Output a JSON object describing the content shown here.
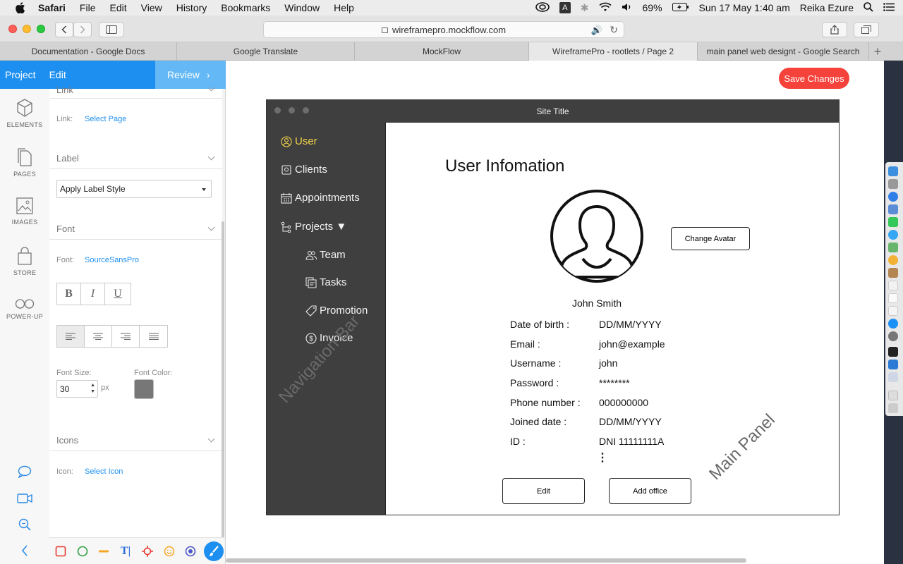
{
  "menubar": {
    "items": [
      "Safari",
      "File",
      "Edit",
      "View",
      "History",
      "Bookmarks",
      "Window",
      "Help"
    ],
    "status": {
      "battery": "69%",
      "datetime": "Sun 17 May  1:40 am",
      "user": "Reika Ezure",
      "input_source": "A"
    }
  },
  "browser": {
    "url": "wireframepro.mockflow.com",
    "tabs": [
      "Documentation - Google Docs",
      "Google Translate",
      "MockFlow",
      "WireframePro - rootlets / Page 2",
      "main panel web designt - Google Search"
    ],
    "active_tab_index": 3
  },
  "editor": {
    "header": {
      "project": "Project",
      "edit": "Edit",
      "review": "Review"
    },
    "nav": [
      {
        "label": "ELEMENTS",
        "icon": "cube-icon"
      },
      {
        "label": "PAGES",
        "icon": "pages-icon"
      },
      {
        "label": "IMAGES",
        "icon": "image-icon"
      },
      {
        "label": "STORE",
        "icon": "bag-icon"
      },
      {
        "label": "POWER-UP",
        "icon": "infinity-icon"
      }
    ],
    "props": {
      "link_section": "Link",
      "link_label": "Link:",
      "link_value": "Select Page",
      "label_section": "Label",
      "label_style": "Apply Label Style",
      "font_section": "Font",
      "font_label": "Font:",
      "font_value": "SourceSansPro",
      "format_buttons": [
        "B",
        "I",
        "U"
      ],
      "font_size_label": "Font Size:",
      "font_size": "30",
      "font_size_unit": "px",
      "font_color_label": "Font Color:",
      "font_color": "#777777",
      "icons_section": "Icons",
      "icon_label": "Icon:",
      "icon_value": "Select Icon"
    },
    "accent_color": "#1d8ff0"
  },
  "canvas": {
    "save_button": "Save Changes",
    "save_color": "#f5423b",
    "wireframe": {
      "site_title": "Site Title",
      "nav_items": [
        {
          "label": "User",
          "icon": "user-icon",
          "active": true
        },
        {
          "label": "Clients",
          "icon": "clients-icon"
        },
        {
          "label": "Appointments",
          "icon": "calendar-icon"
        },
        {
          "label": "Projects ▼",
          "icon": "tree-icon"
        },
        {
          "label": "Team",
          "icon": "team-icon",
          "sub": true
        },
        {
          "label": "Tasks",
          "icon": "tasks-icon",
          "sub": true
        },
        {
          "label": "Promotion",
          "icon": "tag-icon",
          "sub": true
        },
        {
          "label": "Invoice",
          "icon": "dollar-icon",
          "sub": true
        }
      ],
      "nav_watermark": "Navigation Bar",
      "main_title": "User Infomation",
      "change_avatar": "Change Avatar",
      "user_name": "John Smith",
      "fields": [
        {
          "key": "Date of birth :",
          "value": "DD/MM/YYYY"
        },
        {
          "key": "Email :",
          "value": "john@example"
        },
        {
          "key": "Username :",
          "value": "john"
        },
        {
          "key": "Password :",
          "value": "********"
        },
        {
          "key": "Phone number :",
          "value": "000000000"
        },
        {
          "key": "Joined date :",
          "value": "DD/MM/YYYY"
        },
        {
          "key": "ID :",
          "value": "DNI 11111111A"
        }
      ],
      "ellipsis": "⋮",
      "edit_button": "Edit",
      "add_office_button": "Add office",
      "main_watermark": "Main Panel"
    }
  }
}
